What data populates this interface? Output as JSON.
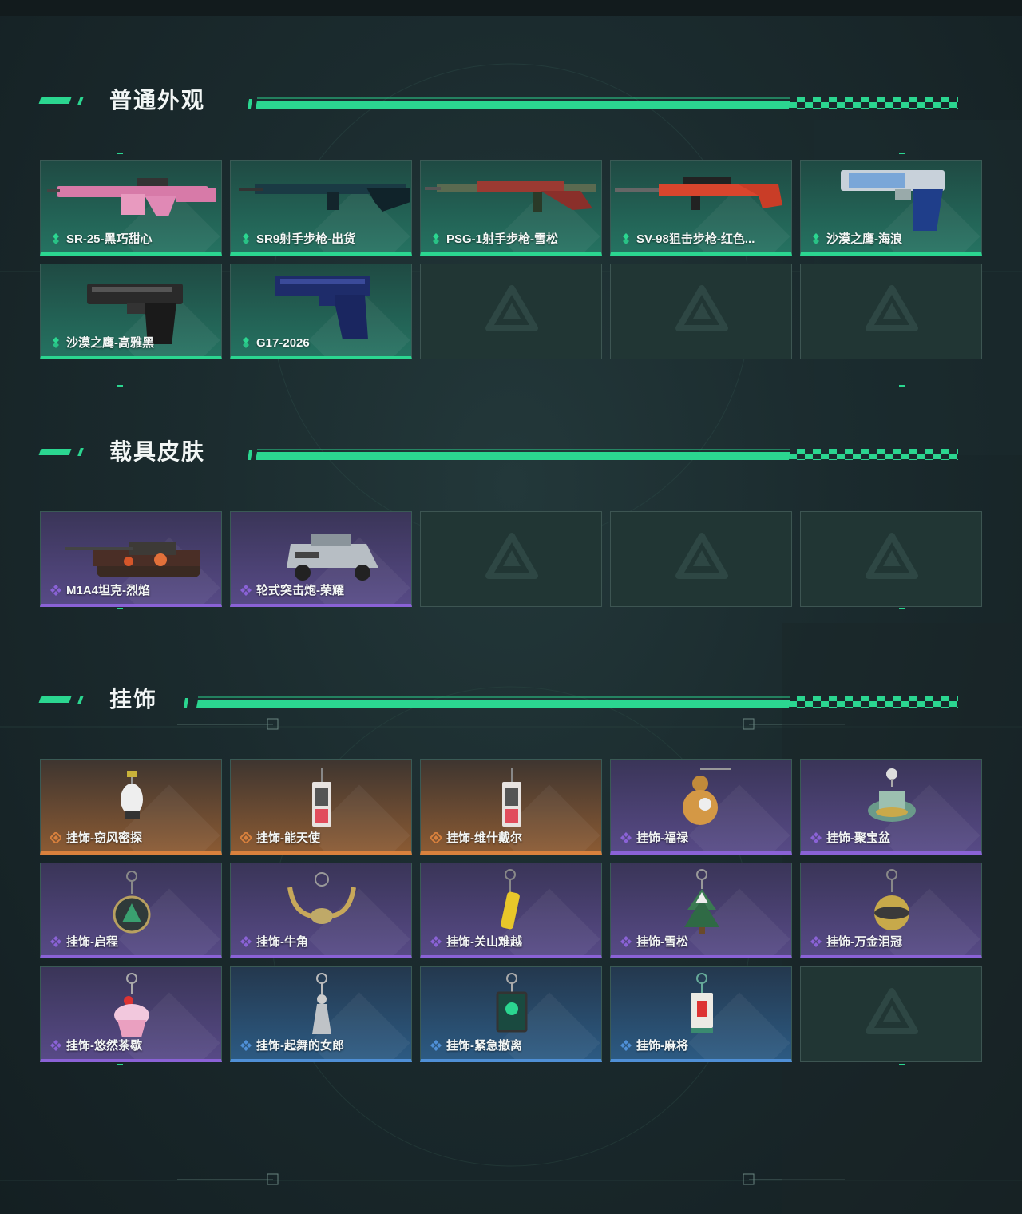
{
  "sections": [
    {
      "title": "普通外观",
      "items": [
        {
          "label": "SR-25-黑巧甜心",
          "rarity": "normal",
          "icon": "rifle-pink-icon"
        },
        {
          "label": "SR9射手步枪-出货",
          "rarity": "normal",
          "icon": "rifle-dark-icon"
        },
        {
          "label": "PSG-1射手步枪-雪松",
          "rarity": "normal",
          "icon": "rifle-red-icon"
        },
        {
          "label": "SV-98狙击步枪-红色...",
          "rarity": "normal",
          "icon": "sniper-red-icon"
        },
        {
          "label": "沙漠之鹰-海浪",
          "rarity": "normal",
          "icon": "pistol-blue-icon"
        },
        {
          "label": "沙漠之鹰-高雅黑",
          "rarity": "normal",
          "icon": "pistol-black-icon"
        },
        {
          "label": "G17-2026",
          "rarity": "normal",
          "icon": "pistol-navy-icon"
        },
        {
          "label": "",
          "rarity": "empty"
        },
        {
          "label": "",
          "rarity": "empty"
        },
        {
          "label": "",
          "rarity": "empty"
        }
      ]
    },
    {
      "title": "载具皮肤",
      "items": [
        {
          "label": "M1A4坦克-烈焰",
          "rarity": "purple",
          "icon": "tank-icon"
        },
        {
          "label": "轮式突击炮-荣耀",
          "rarity": "purple",
          "icon": "armored-car-icon"
        },
        {
          "label": "",
          "rarity": "empty"
        },
        {
          "label": "",
          "rarity": "empty"
        },
        {
          "label": "",
          "rarity": "empty"
        }
      ]
    },
    {
      "title": "挂饰",
      "items": [
        {
          "label": "挂饰-窃风密探",
          "rarity": "orange",
          "icon": "charm-rabbit-icon"
        },
        {
          "label": "挂饰-能天使",
          "rarity": "orange",
          "icon": "charm-card-icon"
        },
        {
          "label": "挂饰-维什戴尔",
          "rarity": "orange",
          "icon": "charm-card-icon"
        },
        {
          "label": "挂饰-福禄",
          "rarity": "purple",
          "icon": "charm-gourd-icon"
        },
        {
          "label": "挂饰-聚宝盆",
          "rarity": "purple",
          "icon": "charm-bowl-icon"
        },
        {
          "label": "挂饰-启程",
          "rarity": "purple",
          "icon": "charm-medal-icon"
        },
        {
          "label": "挂饰-牛角",
          "rarity": "purple",
          "icon": "charm-horns-icon"
        },
        {
          "label": "挂饰-关山难越",
          "rarity": "purple",
          "icon": "charm-tube-icon"
        },
        {
          "label": "挂饰-雪松",
          "rarity": "purple",
          "icon": "charm-tree-icon"
        },
        {
          "label": "挂饰-万金泪冠",
          "rarity": "purple",
          "icon": "charm-crown-icon"
        },
        {
          "label": "挂饰-悠然茶歇",
          "rarity": "purple",
          "icon": "charm-cupcake-icon"
        },
        {
          "label": "挂饰-起舞的女郎",
          "rarity": "blue",
          "icon": "charm-dancer-icon"
        },
        {
          "label": "挂饰-紧急撤离",
          "rarity": "blue",
          "icon": "charm-sign-icon"
        },
        {
          "label": "挂饰-麻将",
          "rarity": "blue",
          "icon": "charm-mahjong-icon"
        },
        {
          "label": "",
          "rarity": "empty"
        }
      ]
    }
  ],
  "colors": {
    "accent": "#2bd690",
    "normal": "#2bd690",
    "purple": "#8a62d6",
    "orange": "#d9813d",
    "blue": "#4f8fd6"
  }
}
